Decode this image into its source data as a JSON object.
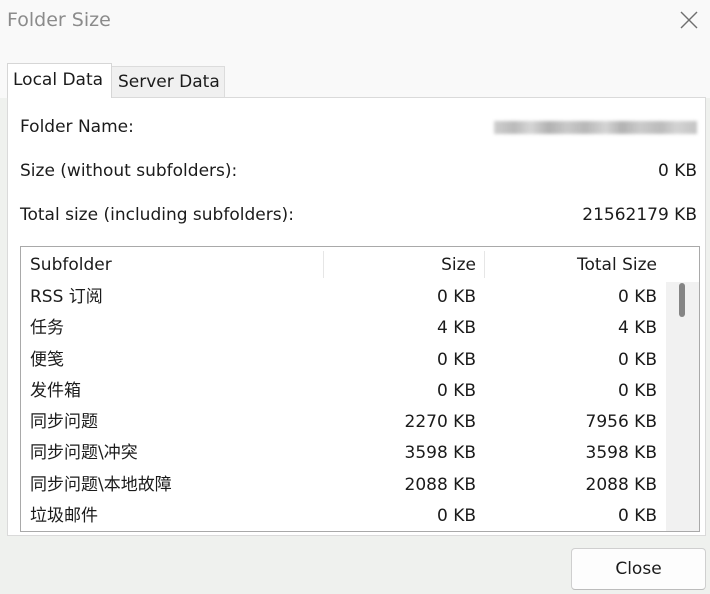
{
  "window": {
    "title": "Folder Size"
  },
  "icons": {
    "window_close": "close-icon"
  },
  "tabs": [
    {
      "label": "Local Data",
      "selected": true
    },
    {
      "label": "Server Data",
      "selected": false
    }
  ],
  "info": {
    "folder_name_label": "Folder Name:",
    "size_label": "Size (without subfolders):",
    "size_value": "0 KB",
    "total_size_label": "Total size (including subfolders):",
    "total_size_value": "21562179 KB"
  },
  "subfolder_list": {
    "columns": {
      "subfolder": "Subfolder",
      "size": "Size",
      "total_size": "Total Size"
    },
    "rows": [
      {
        "subfolder": "RSS 订阅",
        "size": "0 KB",
        "total_size": "0 KB"
      },
      {
        "subfolder": "任务",
        "size": "4 KB",
        "total_size": "4 KB"
      },
      {
        "subfolder": "便笺",
        "size": "0 KB",
        "total_size": "0 KB"
      },
      {
        "subfolder": "发件箱",
        "size": "0 KB",
        "total_size": "0 KB"
      },
      {
        "subfolder": "同步问题",
        "size": "2270 KB",
        "total_size": "7956 KB"
      },
      {
        "subfolder": "同步问题\\冲突",
        "size": "3598 KB",
        "total_size": "3598 KB"
      },
      {
        "subfolder": "同步问题\\本地故障",
        "size": "2088 KB",
        "total_size": "2088 KB"
      },
      {
        "subfolder": "垃圾邮件",
        "size": "0 KB",
        "total_size": "0 KB"
      }
    ],
    "scroll_position": 0
  },
  "footer": {
    "close_label": "Close"
  },
  "colors": {
    "title_text": "#8b8b8b",
    "text": "#1b1b1b",
    "chrome_bg": "#f9f9f9",
    "footer_bg": "#eff1ee",
    "scroll_thumb": "#858585"
  }
}
